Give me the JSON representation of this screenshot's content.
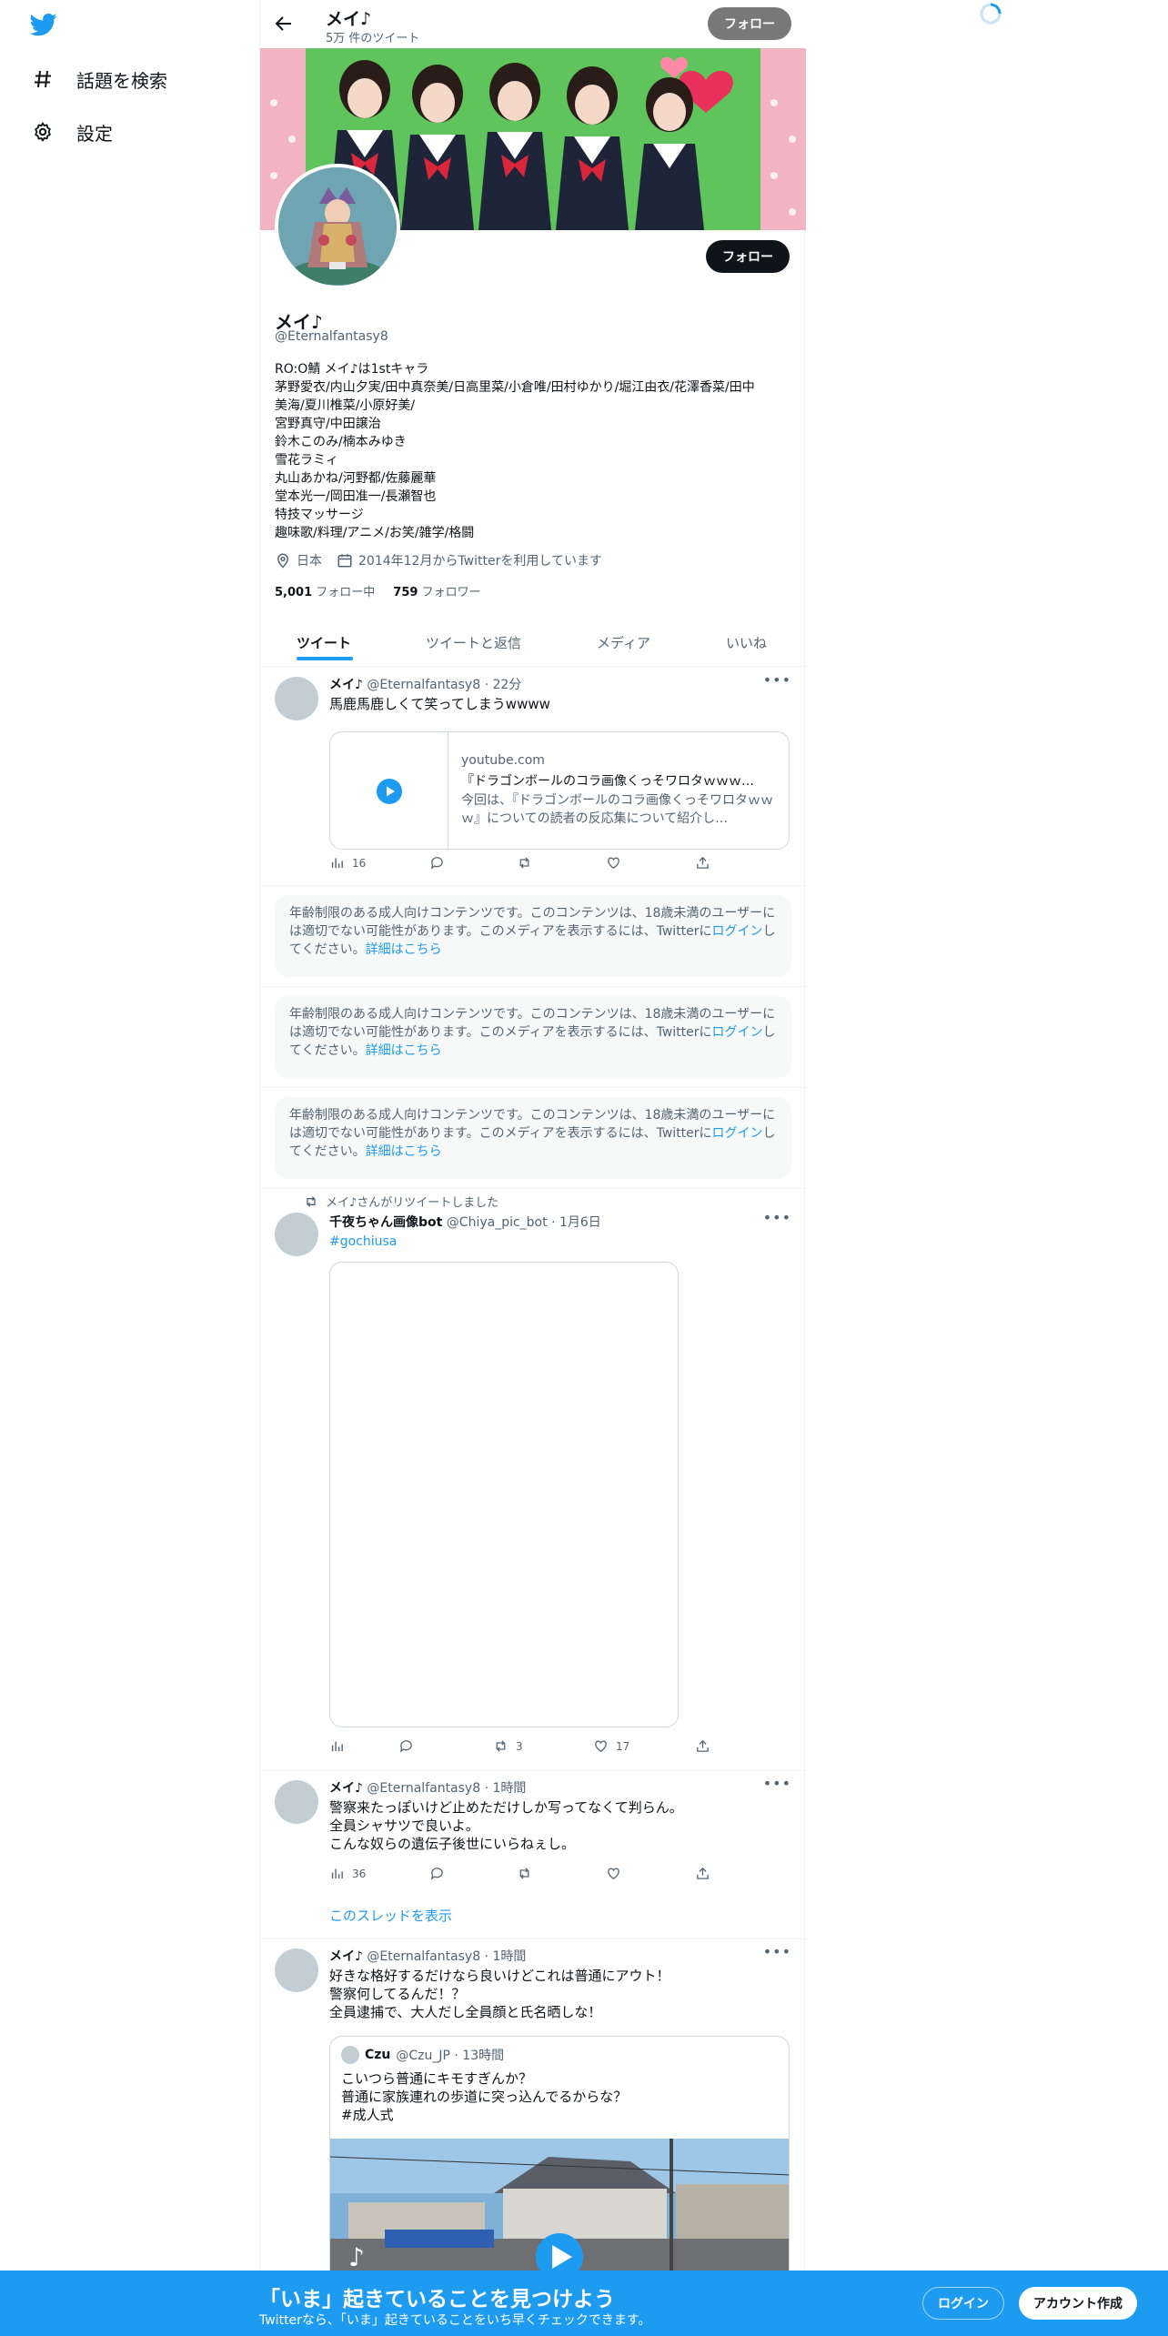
{
  "nav": {
    "logo": "twitter-bird-icon",
    "items": [
      {
        "label": "話題を検索",
        "icon": "hashtag-icon"
      },
      {
        "label": "設定",
        "icon": "gear-icon"
      }
    ]
  },
  "header": {
    "name": "メイ♪",
    "tweet_count": "5万 件のツイート",
    "follow_label": "フォロー"
  },
  "profile": {
    "name": "メイ♪",
    "handle": "@Eternalfantasy8",
    "follow_label": "フォロー",
    "bio_lines": [
      "RO:O鯖 メイ♪は1stキャラ",
      "茅野愛衣/内山夕実/田中真奈美/日高里菜/小倉唯/田村ゆかり/堀江由衣/花澤香菜/田中",
      "美海/夏川椎菜/小原好美/",
      "宮野真守/中田譲治",
      "鈴木このみ/楠本みゆき",
      "雪花ラミィ",
      "丸山あかね/河野都/佐藤麗華",
      "堂本光一/岡田准一/長瀬智也",
      "特技マッサージ",
      "趣味歌/料理/アニメ/お笑/雑学/格闘"
    ],
    "location": "日本",
    "joined": "2014年12月からTwitterを利用しています",
    "following_count": "5,001",
    "following_label": "フォロー中",
    "followers_count": "759",
    "followers_label": "フォロワー"
  },
  "tabs": [
    {
      "label": "ツイート",
      "active": true
    },
    {
      "label": "ツイートと返信",
      "active": false
    },
    {
      "label": "メディア",
      "active": false
    },
    {
      "label": "いいね",
      "active": false
    }
  ],
  "tweets": {
    "t1": {
      "name": "メイ♪",
      "meta": "@Eternalfantasy8 · 22分",
      "text": "馬鹿馬鹿しくて笑ってしまうwwww",
      "card": {
        "domain": "youtube.com",
        "title": "『ドラゴンボールのコラ画像くっそワロタｗｗｗ…",
        "desc": "今回は、『ドラゴンボールのコラ画像くっそワロタｗｗｗ』についての読者の反応集について紹介し…"
      },
      "views": "16"
    },
    "age_notice": {
      "text_before": "年齢制限のある成人向けコンテンツです。このコンテンツは、18歳未満のユーザーには適切でない可能性があります。このメディアを表示するには、Twitterに",
      "login": "ログイン",
      "text_after": "してください。",
      "details": "詳細はこちら"
    },
    "t2": {
      "rt_label": "メイ♪さんがリツイートしました",
      "name": "千夜ちゃん画像bot",
      "meta": "@Chiya_pic_bot · 1月6日",
      "hashtag": "#gochiusa",
      "retweets": "3",
      "likes": "17"
    },
    "t3": {
      "name": "メイ♪",
      "meta": "@Eternalfantasy8 · 1時間",
      "lines": [
        "警察来たっぽいけど止めただけしか写ってなくて判らん。",
        "全員シャサツで良いよ。",
        "こんな奴らの遺伝子後世にいらねぇし。"
      ],
      "views": "36",
      "thread_link": "このスレッドを表示"
    },
    "t4": {
      "name": "メイ♪",
      "meta": "@Eternalfantasy8 · 1時間",
      "lines": [
        "好きな格好するだけなら良いけどこれは普通にアウト！",
        "警察何してるんだ！？",
        "全員逮捕で、大人だし全員顔と氏名晒しな！"
      ],
      "quote": {
        "name": "Czu",
        "meta": "@Czu_JP · 13時間",
        "lines": [
          "こいつら普通にキモすぎんか？",
          "普通に家族連れの歩道に突っ込んでるからな？",
          " #成人式"
        ]
      }
    }
  },
  "bottom_bar": {
    "title": "「いま」起きていることを見つけよう",
    "subtitle": "Twitterなら、「いま」起きていることをいち早くチェックできます。",
    "login": "ログイン",
    "signup": "アカウント作成"
  },
  "colors": {
    "accent": "#1d9bf0",
    "text": "#0f1419",
    "secondary": "#536471"
  }
}
